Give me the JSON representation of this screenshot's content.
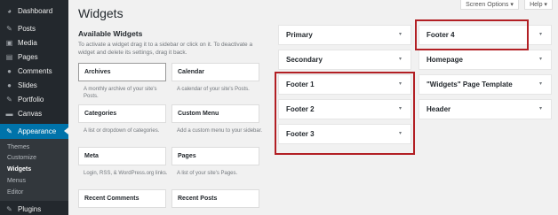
{
  "sidebar": {
    "items": [
      {
        "label": "Dashboard",
        "icon": "dashboard-icon",
        "glyph": "◕"
      },
      {
        "label": "Posts",
        "icon": "pin-icon",
        "glyph": "✎"
      },
      {
        "label": "Media",
        "icon": "media-icon",
        "glyph": "▣"
      },
      {
        "label": "Pages",
        "icon": "page-icon",
        "glyph": "▤"
      },
      {
        "label": "Comments",
        "icon": "comment-icon",
        "glyph": "●"
      },
      {
        "label": "Slides",
        "icon": "slides-icon",
        "glyph": "●"
      },
      {
        "label": "Portfolio",
        "icon": "portfolio-icon",
        "glyph": "✎"
      },
      {
        "label": "Canvas",
        "icon": "canvas-icon",
        "glyph": "▬"
      },
      {
        "label": "Appearance",
        "icon": "brush-icon",
        "glyph": "✎"
      }
    ],
    "submenu": [
      "Themes",
      "Customize",
      "Widgets",
      "Menus",
      "Editor"
    ],
    "plugins": {
      "label": "Plugins",
      "glyph": "✎"
    }
  },
  "header": {
    "title": "Widgets",
    "screen_options": "Screen Options ▾",
    "help": "Help ▾"
  },
  "available": {
    "title": "Available Widgets",
    "description": "To activate a widget drag it to a sidebar or click on it. To deactivate a widget and delete its settings, drag it back.",
    "widgets": [
      {
        "name": "Archives",
        "desc": "A monthly archive of your site's Posts."
      },
      {
        "name": "Calendar",
        "desc": "A calendar of your site's Posts."
      },
      {
        "name": "Categories",
        "desc": "A list or dropdown of categories."
      },
      {
        "name": "Custom Menu",
        "desc": "Add a custom menu to your sidebar."
      },
      {
        "name": "Meta",
        "desc": "Login, RSS, & WordPress.org links."
      },
      {
        "name": "Pages",
        "desc": "A list of your site's Pages."
      },
      {
        "name": "Recent Comments",
        "desc": ""
      },
      {
        "name": "Recent Posts",
        "desc": ""
      }
    ]
  },
  "areas": {
    "left": [
      "Primary",
      "Secondary",
      "Footer 1",
      "Footer 2",
      "Footer 3"
    ],
    "right": [
      "Footer 4",
      "Homepage",
      "\"Widgets\" Page Template",
      "Header"
    ],
    "caret": "▾"
  },
  "colors": {
    "highlight": "#b21f24",
    "sidebar_bg": "#23282d",
    "current": "#0073aa"
  }
}
